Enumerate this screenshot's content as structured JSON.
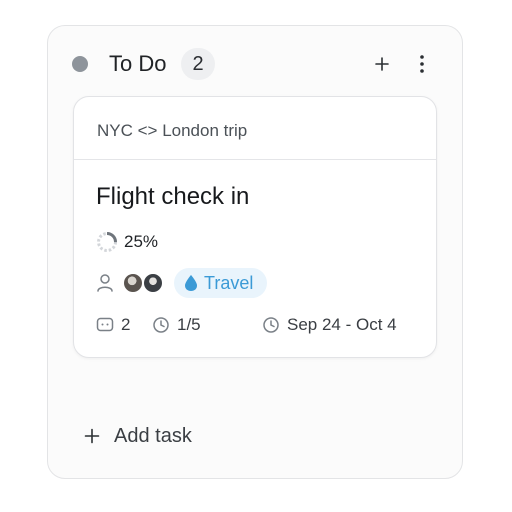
{
  "column": {
    "title": "To Do",
    "count": "2"
  },
  "card": {
    "project": "NYC <> London trip",
    "title": "Flight check in",
    "progress_label": "25%",
    "progress_value": 0.25,
    "tag": {
      "label": "Travel",
      "icon": "water-drop-icon",
      "color": "#3b9ad6"
    },
    "comments_count": "2",
    "subtasks": "1/5",
    "date_range": "Sep 24 - Oct 4"
  },
  "add_task_label": "Add task",
  "colors": {
    "status_dot": "#8e949b",
    "tag_bg": "#e9f4fc",
    "accent": "#3b9ad6"
  }
}
